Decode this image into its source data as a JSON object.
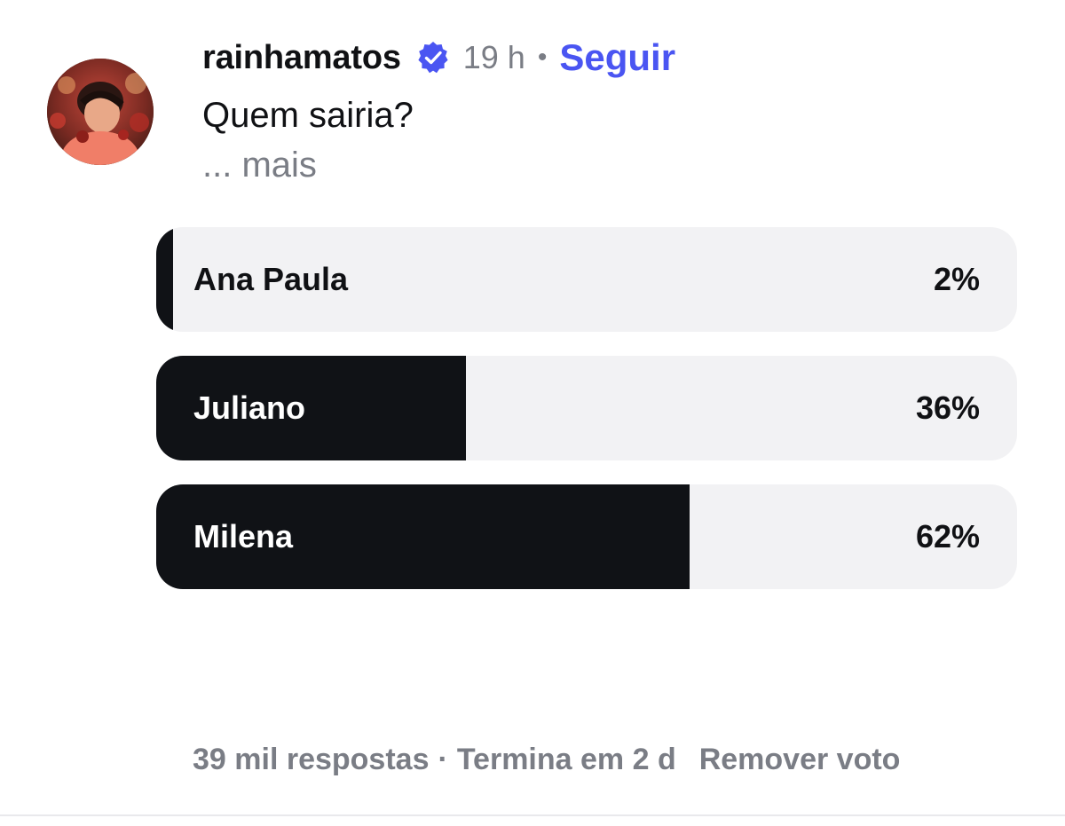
{
  "post": {
    "username": "rainhamatos",
    "time": "19 h",
    "separator": "•",
    "follow_label": "Seguir",
    "text": "Quem sairia?",
    "more_label": "... mais"
  },
  "poll": {
    "options": [
      {
        "label": "Ana Paula",
        "percent_label": "2%",
        "percent": 2
      },
      {
        "label": "Juliano",
        "percent_label": "36%",
        "percent": 36
      },
      {
        "label": "Milena",
        "percent_label": "62%",
        "percent": 62
      }
    ],
    "responses": "39 mil respostas",
    "separator": "·",
    "ends": "Termina em 2 d",
    "remove_vote_label": "Remover voto"
  },
  "colors": {
    "accent": "#4a55f2",
    "verified": "#4a55f2",
    "fill": "#101216",
    "track": "#f2f2f4",
    "muted": "#7a7d85"
  },
  "icons": {
    "verified": "verified-badge-icon"
  }
}
